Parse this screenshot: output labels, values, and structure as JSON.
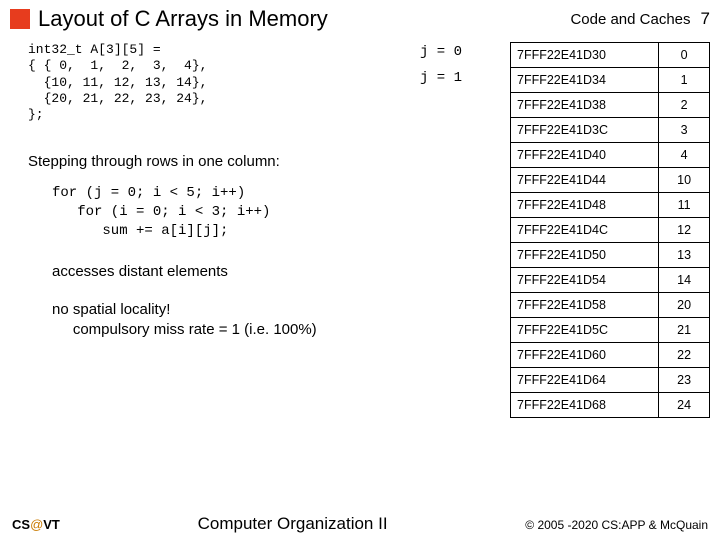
{
  "header": {
    "title": "Layout of C Arrays in Memory",
    "section": "Code and Caches",
    "page": "7"
  },
  "code_decl": "int32_t A[3][5] =\n{ { 0,  1,  2,  3,  4},\n  {10, 11, 12, 13, 14},\n  {20, 21, 22, 23, 24},\n};",
  "j_labels": {
    "j0": "j = 0",
    "j1": "j = 1"
  },
  "step_text": "Stepping through rows in one column:",
  "loop_code": "for (j = 0; i < 5; i++)\n   for (i = 0; i < 3; i++)\n      sum += a[i][j];",
  "access_text": "accesses distant elements",
  "locality_line1": "no spatial locality!",
  "locality_line2": "compulsory miss rate = 1 (i.e. 100%)",
  "mem_table": [
    {
      "addr": "7FFF22E41D30",
      "val": "0"
    },
    {
      "addr": "7FFF22E41D34",
      "val": "1"
    },
    {
      "addr": "7FFF22E41D38",
      "val": "2"
    },
    {
      "addr": "7FFF22E41D3C",
      "val": "3"
    },
    {
      "addr": "7FFF22E41D40",
      "val": "4"
    },
    {
      "addr": "7FFF22E41D44",
      "val": "10"
    },
    {
      "addr": "7FFF22E41D48",
      "val": "11"
    },
    {
      "addr": "7FFF22E41D4C",
      "val": "12"
    },
    {
      "addr": "7FFF22E41D50",
      "val": "13"
    },
    {
      "addr": "7FFF22E41D54",
      "val": "14"
    },
    {
      "addr": "7FFF22E41D58",
      "val": "20"
    },
    {
      "addr": "7FFF22E41D5C",
      "val": "21"
    },
    {
      "addr": "7FFF22E41D60",
      "val": "22"
    },
    {
      "addr": "7FFF22E41D64",
      "val": "23"
    },
    {
      "addr": "7FFF22E41D68",
      "val": "24"
    }
  ],
  "footer": {
    "left_cs": "CS",
    "left_at": "@",
    "left_vt": "VT",
    "center": "Computer Organization II",
    "right": "© 2005 -2020 CS:APP & McQuain"
  }
}
